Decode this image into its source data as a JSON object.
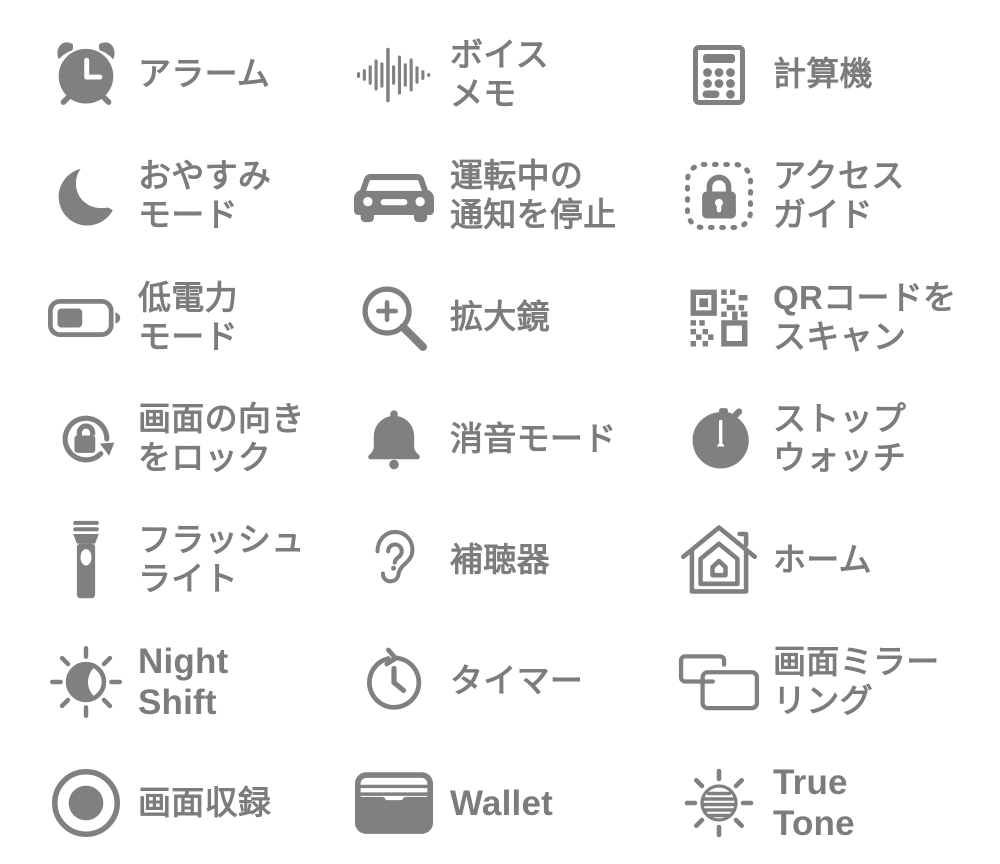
{
  "page": {
    "title": "iOS Control Center / Accessibility shortcut icon list",
    "background_color": "#ffffff",
    "icon_color": "#808080",
    "label_color": "#7c7c7c",
    "columns": 3,
    "rows": 7
  },
  "items": [
    {
      "icon": "alarm-clock-icon",
      "label": "アラーム",
      "script": "jp",
      "row": 1,
      "col": 1
    },
    {
      "icon": "voice-memo-waveform-icon",
      "label": "ボイス\nメモ",
      "script": "jp",
      "row": 1,
      "col": 2
    },
    {
      "icon": "calculator-icon",
      "label": "計算機",
      "script": "jp",
      "row": 1,
      "col": 3
    },
    {
      "icon": "crescent-moon-icon",
      "label": "おやすみ\nモード",
      "script": "jp",
      "row": 2,
      "col": 1
    },
    {
      "icon": "car-icon",
      "label": "運転中の\n通知を停止",
      "script": "jp",
      "row": 2,
      "col": 2
    },
    {
      "icon": "guided-access-lock-icon",
      "label": "アクセス\nガイド",
      "script": "jp",
      "row": 2,
      "col": 3
    },
    {
      "icon": "low-battery-icon",
      "label": "低電力\nモード",
      "script": "jp",
      "row": 3,
      "col": 1
    },
    {
      "icon": "magnifier-plus-icon",
      "label": "拡大鏡",
      "script": "jp",
      "row": 3,
      "col": 2
    },
    {
      "icon": "qr-code-icon",
      "label": "QRコードを\nスキャン",
      "script": "jp",
      "row": 3,
      "col": 3
    },
    {
      "icon": "rotation-lock-icon",
      "label": "画面の向き\nをロック",
      "script": "jp",
      "row": 4,
      "col": 1
    },
    {
      "icon": "bell-icon",
      "label": "消音モード",
      "script": "jp",
      "row": 4,
      "col": 2
    },
    {
      "icon": "stopwatch-icon",
      "label": "ストップ\nウォッチ",
      "script": "jp",
      "row": 4,
      "col": 3
    },
    {
      "icon": "flashlight-icon",
      "label": "フラッシュ\nライト",
      "script": "jp",
      "row": 5,
      "col": 1
    },
    {
      "icon": "ear-hearing-icon",
      "label": "補聴器",
      "script": "jp",
      "row": 5,
      "col": 2
    },
    {
      "icon": "home-house-icon",
      "label": "ホーム",
      "script": "jp",
      "row": 5,
      "col": 3
    },
    {
      "icon": "night-shift-icon",
      "label": "Night\nShift",
      "script": "latin",
      "row": 6,
      "col": 1
    },
    {
      "icon": "timer-icon",
      "label": "タイマー",
      "script": "jp",
      "row": 6,
      "col": 2
    },
    {
      "icon": "screen-mirroring-icon",
      "label": "画面ミラー\nリング",
      "script": "jp",
      "row": 6,
      "col": 3
    },
    {
      "icon": "screen-record-icon",
      "label": "画面収録",
      "script": "jp",
      "row": 7,
      "col": 1
    },
    {
      "icon": "wallet-icon",
      "label": "Wallet",
      "script": "latin",
      "row": 7,
      "col": 2
    },
    {
      "icon": "true-tone-icon",
      "label": "True\nTone",
      "script": "latin",
      "row": 7,
      "col": 3
    }
  ]
}
